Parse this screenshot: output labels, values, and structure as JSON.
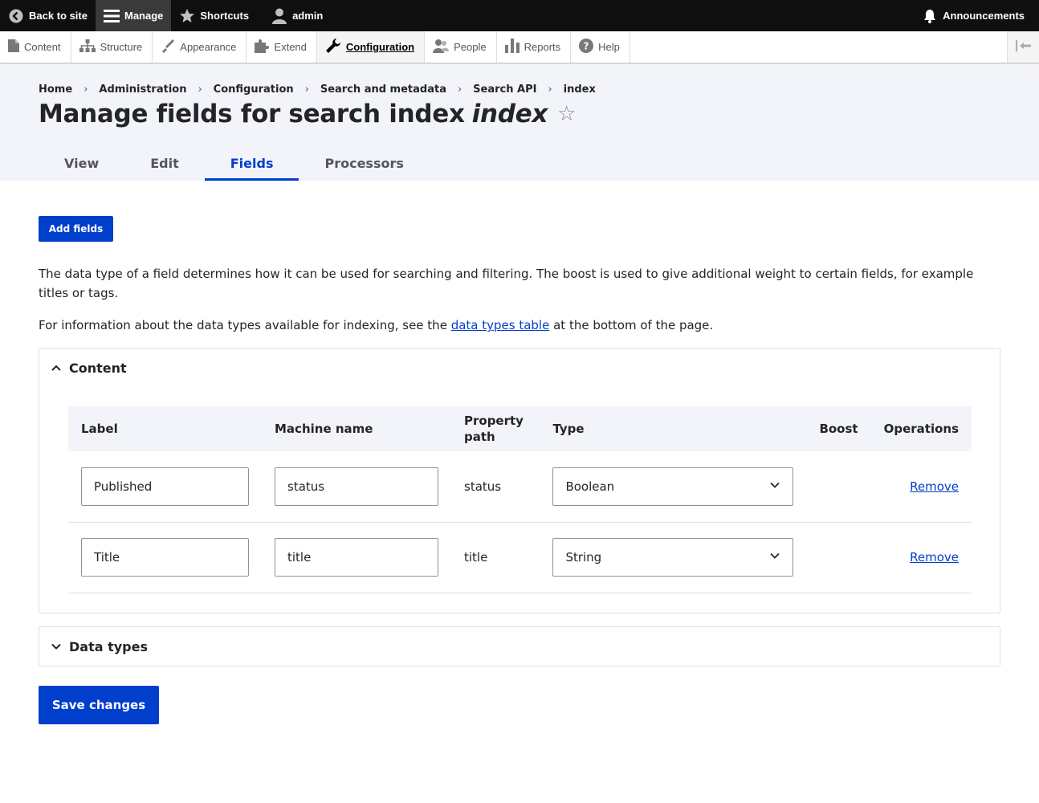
{
  "toolbar": {
    "back_to_site": "Back to site",
    "manage": "Manage",
    "shortcuts": "Shortcuts",
    "user": "admin",
    "announcements": "Announcements"
  },
  "tray": {
    "items": [
      "Content",
      "Structure",
      "Appearance",
      "Extend",
      "Configuration",
      "People",
      "Reports",
      "Help"
    ],
    "active": "Configuration"
  },
  "breadcrumb": [
    "Home",
    "Administration",
    "Configuration",
    "Search and metadata",
    "Search API",
    "index"
  ],
  "page_title": {
    "prefix": "Manage fields for search index",
    "emphasis": "index",
    "star": "☆"
  },
  "tabs": [
    "View",
    "Edit",
    "Fields",
    "Processors"
  ],
  "active_tab": "Fields",
  "add_fields_label": "Add fields",
  "description": {
    "line1": "The data type of a field determines how it can be used for searching and filtering. The boost is used to give additional weight to certain fields, for example titles or tags.",
    "line2_before": "For information about the data types available for indexing, see the ",
    "line2_link": "data types table",
    "line2_after": " at the bottom of the page."
  },
  "content_section": {
    "title": "Content",
    "columns": {
      "label": "Label",
      "machine_name": "Machine name",
      "property_path_1": "Property",
      "property_path_2": "path",
      "type": "Type",
      "boost": "Boost",
      "operations": "Operations"
    },
    "rows": [
      {
        "label": "Published",
        "machine_name": "status",
        "property_path": "status",
        "type": "Boolean",
        "operation": "Remove"
      },
      {
        "label": "Title",
        "machine_name": "title",
        "property_path": "title",
        "type": "String",
        "operation": "Remove"
      }
    ]
  },
  "data_types_section": {
    "title": "Data types"
  },
  "save_label": "Save changes"
}
